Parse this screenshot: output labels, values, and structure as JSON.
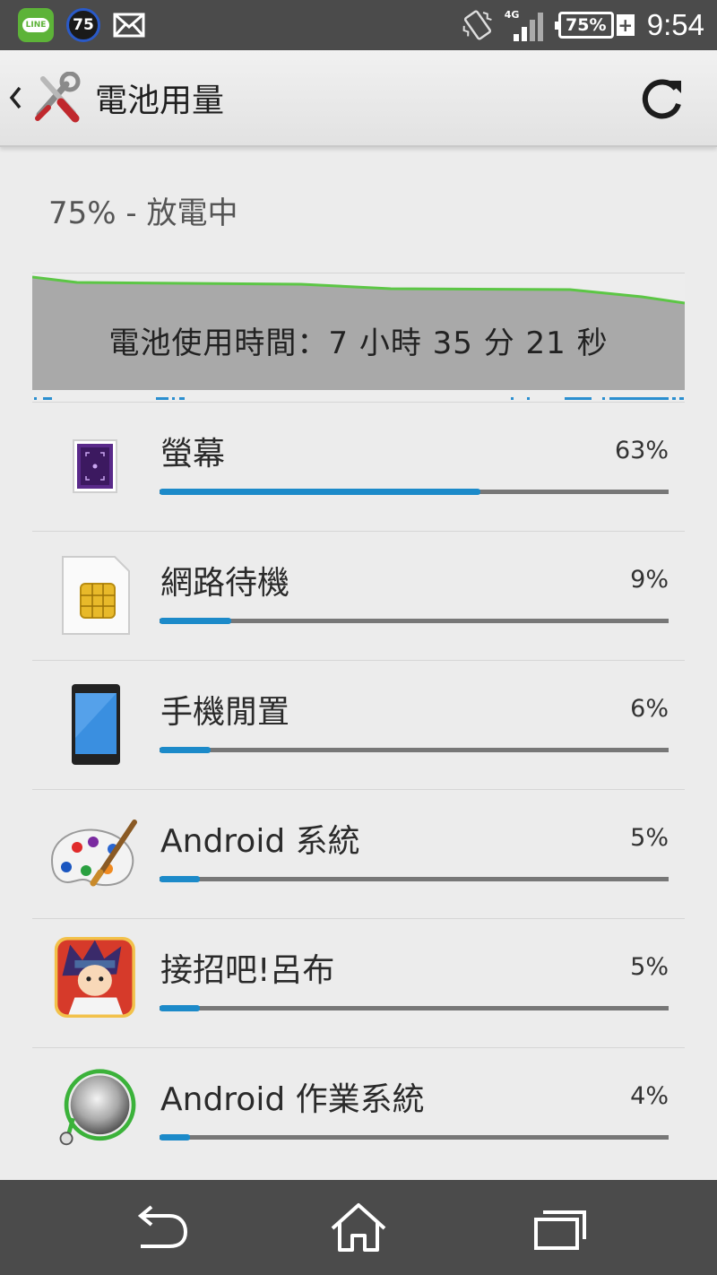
{
  "status_bar": {
    "line_label": "LINE",
    "badge_count": "75",
    "network": "4G",
    "battery": "75%",
    "time": "9:54",
    "icons": [
      "line-app-icon",
      "notification-badge-icon",
      "mail-icon",
      "vibrate-icon",
      "signal-icon",
      "battery-icon",
      "charging-plus-icon"
    ]
  },
  "action_bar": {
    "title": "電池用量",
    "back_icon": "chevron-left-icon",
    "app_icon": "settings-tools-icon",
    "refresh_icon": "refresh-icon"
  },
  "summary": "75% - 放電中",
  "graph": {
    "caption": "電池使用時間：7 小時 35 分 21 秒",
    "line_color": "#5cc645",
    "fill_color": "#a9a9a9"
  },
  "items": [
    {
      "name": "螢幕",
      "percent": "63%",
      "fraction": 0.63,
      "icon": "screen-icon"
    },
    {
      "name": "網路待機",
      "percent": "9%",
      "fraction": 0.14,
      "icon": "sim-card-icon"
    },
    {
      "name": "手機閒置",
      "percent": "6%",
      "fraction": 0.1,
      "icon": "phone-icon"
    },
    {
      "name": "Android 系統",
      "percent": "5%",
      "fraction": 0.08,
      "icon": "palette-icon"
    },
    {
      "name": "接招吧!呂布",
      "percent": "5%",
      "fraction": 0.08,
      "icon": "game-app-icon"
    },
    {
      "name": "Android 作業系統",
      "percent": "4%",
      "fraction": 0.06,
      "icon": "os-knob-icon"
    }
  ],
  "colors": {
    "accent": "#1c8ac9",
    "status_bar": "#4b4b4b",
    "background": "#ececec"
  },
  "nav_bar": {
    "icons": [
      "back-icon",
      "home-icon",
      "recent-apps-icon"
    ]
  }
}
